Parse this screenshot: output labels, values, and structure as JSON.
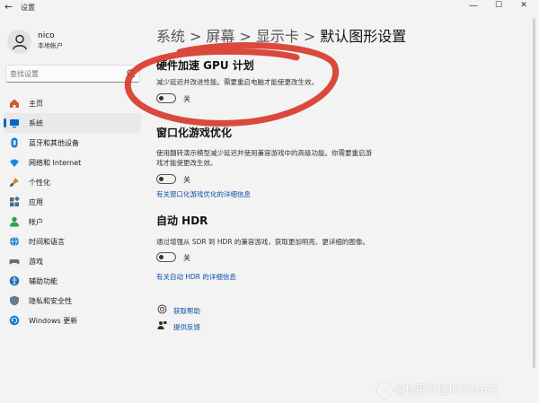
{
  "window": {
    "title": "设置",
    "back_glyph": "←",
    "minimize_glyph": "—",
    "maximize_glyph": "☐",
    "close_glyph": "✕"
  },
  "user": {
    "name": "nico",
    "account_type": "本地帐户"
  },
  "search": {
    "placeholder": "查找设置"
  },
  "nav": {
    "items": [
      {
        "label": "主页",
        "icon": "home-icon",
        "color": "#d35a2a"
      },
      {
        "label": "系统",
        "icon": "system-icon",
        "color": "#0067c0",
        "selected": true
      },
      {
        "label": "蓝牙和其他设备",
        "icon": "bluetooth-icon",
        "color": "#0a74d0"
      },
      {
        "label": "网络和 Internet",
        "icon": "wifi-icon",
        "color": "#1e88d8"
      },
      {
        "label": "个性化",
        "icon": "brush-icon",
        "color": "#d98a2b"
      },
      {
        "label": "应用",
        "icon": "apps-icon",
        "color": "#4a6e8c"
      },
      {
        "label": "帐户",
        "icon": "account-icon",
        "color": "#2aa05a"
      },
      {
        "label": "时间和语言",
        "icon": "globe-icon",
        "color": "#1c7ac8"
      },
      {
        "label": "游戏",
        "icon": "gamepad-icon",
        "color": "#6b6b6b"
      },
      {
        "label": "辅助功能",
        "icon": "accessibility-icon",
        "color": "#1f6fb5"
      },
      {
        "label": "隐私和安全性",
        "icon": "shield-icon",
        "color": "#6b7b8b"
      },
      {
        "label": "Windows 更新",
        "icon": "update-icon",
        "color": "#1a7ad0"
      }
    ]
  },
  "breadcrumb": {
    "items": [
      "系统",
      "屏幕",
      "显示卡"
    ],
    "separator": ">",
    "current": "默认图形设置"
  },
  "sections": {
    "gpu": {
      "title": "硬件加速 GPU 计划",
      "description": "减少延迟并改进性能。需要重启电脑才能使更改生效。",
      "toggle_state": "关",
      "toggle_on": false
    },
    "windowed": {
      "title": "窗口化游戏优化",
      "description_line1": "使用翻转演示模型减少延迟并使用兼容游戏中的高级功能。你需要重启游",
      "description_line2": "戏才能使更改生效。",
      "toggle_state": "关",
      "toggle_on": false,
      "link": "有关窗口化游戏优化的详细信息"
    },
    "hdr": {
      "title": "自动 HDR",
      "description": "通过增强从 SDR 到 HDR 的兼容游戏，获取更加明亮、更详细的图像。",
      "toggle_state": "关",
      "toggle_on": false,
      "link": "有关自动 HDR 的详细信息"
    }
  },
  "help": {
    "get_help": "获取帮助",
    "feedback": "提供反馈"
  },
  "watermark": {
    "text": "@极限竞速地平线6吧"
  },
  "annotation": {
    "color": "#d9392c"
  }
}
